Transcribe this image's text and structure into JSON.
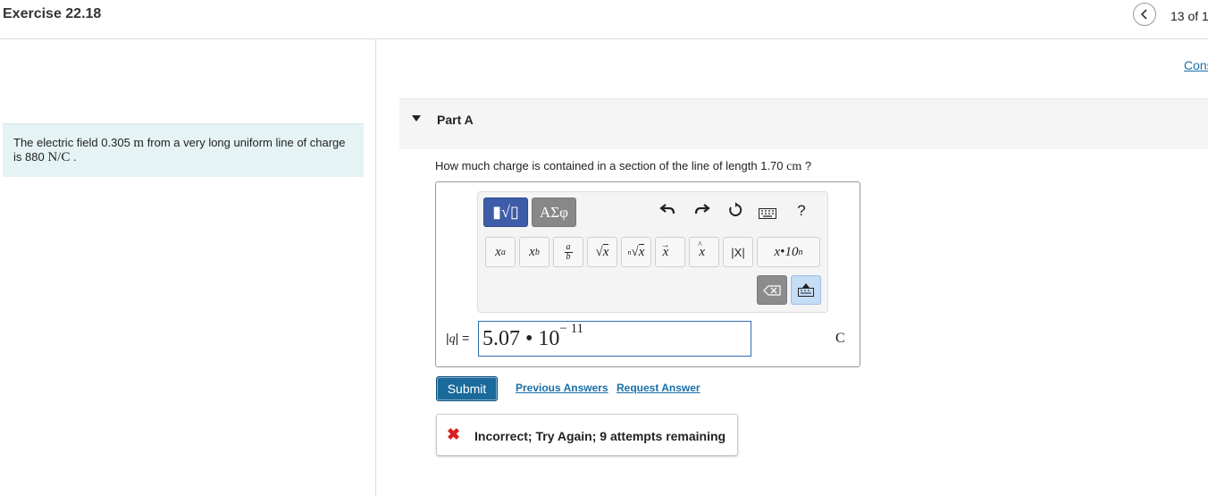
{
  "header": {
    "title": "Exercise 22.18",
    "page_counter": "13 of 1",
    "prev_icon": "chevron-left-icon"
  },
  "side_link": "Cons",
  "problem": {
    "text_a": "The electric field 0.305 ",
    "unit_a": "m",
    "text_b": " from a very long uniform line of charge is 880 ",
    "unit_b": "N/C",
    "text_c": " ."
  },
  "part": {
    "title": "Part A",
    "question_a": "How much charge is contained in a section of the line of length 1.70 ",
    "question_unit": "cm",
    "question_b": " ?"
  },
  "toolbar": {
    "template_label": "▮√▯",
    "greek_label": "ΑΣφ",
    "undo_icon": "undo-icon",
    "redo_icon": "redo-icon",
    "reset_icon": "reset-icon",
    "keyboard_icon": "keyboard-icon",
    "help_label": "?",
    "symbols": {
      "superscript": "xa",
      "subscript": "xb",
      "fraction": "a/b",
      "sqrt": "√x",
      "nthroot": "ⁿ√x",
      "vector": "x⃗",
      "unitvec": "x̂",
      "abs": "|x|",
      "sci": "x•10n"
    }
  },
  "answer": {
    "label_pre": "|",
    "label_var": "q",
    "label_post": "| =",
    "value_base": "5.07 • 10",
    "value_exp": "− 11",
    "unit": "C"
  },
  "actions": {
    "submit": "Submit",
    "previous_answers": "Previous Answers",
    "request_answer": "Request Answer"
  },
  "feedback": {
    "icon": "x-mark-icon",
    "text": "Incorrect; Try Again; 9 attempts remaining",
    "color": "#d92020"
  }
}
